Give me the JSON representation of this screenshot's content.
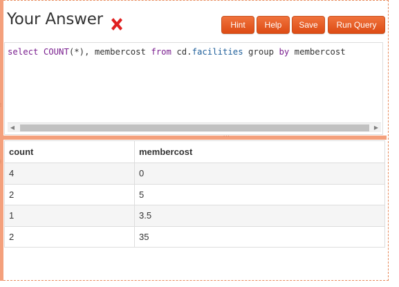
{
  "header": {
    "title": "Your Answer",
    "status_icon": "x-mark-icon",
    "status_color": "#e02020"
  },
  "toolbar": {
    "hint_label": "Hint",
    "help_label": "Help",
    "save_label": "Save",
    "run_label": "Run Query",
    "button_color": "#e55a22"
  },
  "editor": {
    "tokens": [
      {
        "text": "select ",
        "kind": "kw"
      },
      {
        "text": "COUNT",
        "kind": "fn"
      },
      {
        "text": "(*), membercost ",
        "kind": "plain"
      },
      {
        "text": "from",
        "kind": "kw"
      },
      {
        "text": " cd.",
        "kind": "plain"
      },
      {
        "text": "facilities",
        "kind": "attr"
      },
      {
        "text": " group ",
        "kind": "plain"
      },
      {
        "text": "by",
        "kind": "kw"
      },
      {
        "text": " membercost",
        "kind": "plain"
      }
    ]
  },
  "results": {
    "columns": [
      "count",
      "membercost"
    ],
    "rows": [
      [
        "4",
        "0"
      ],
      [
        "2",
        "5"
      ],
      [
        "1",
        "3.5"
      ],
      [
        "2",
        "35"
      ]
    ]
  }
}
